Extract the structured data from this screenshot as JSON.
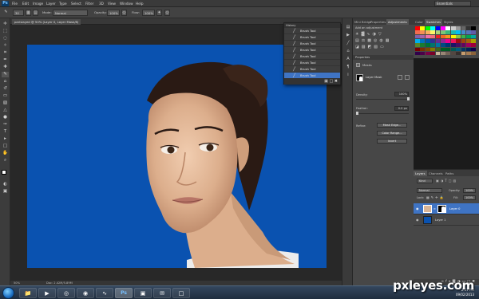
{
  "app": {
    "logo": "Ps",
    "workspace": "Essentials"
  },
  "menu": [
    "File",
    "Edit",
    "Image",
    "Layer",
    "Type",
    "Select",
    "Filter",
    "3D",
    "View",
    "Window",
    "Help"
  ],
  "options": {
    "mode_label": "Mode:",
    "mode_value": "Normal",
    "opacity_label": "Opacity:",
    "opacity_value": "100%",
    "flow_label": "Flow:",
    "flow_value": "100%",
    "brush_size": "30"
  },
  "document": {
    "tab_title": "parislayed @ 50% (Layer 0, Layer Mask/8)"
  },
  "history": {
    "tabs": [
      "History",
      "Actions"
    ],
    "items": [
      "Brush Tool",
      "Brush Tool",
      "Brush Tool",
      "Brush Tool",
      "Brush Tool",
      "Brush Tool",
      "Brush Tool",
      "Brush Tool"
    ]
  },
  "panels": {
    "tabs": [
      "Mini Bridge",
      "Properties",
      "Adjustments"
    ],
    "adjustments_label": "Add an adjustment",
    "properties_title": "Masks",
    "layer_mask_label": "Layer Mask",
    "density_label": "Density:",
    "density_value": "100%",
    "feather_label": "Feather:",
    "feather_value": "0.0 px",
    "refine_label": "Refine:",
    "mask_edge_btn": "Mask Edge...",
    "color_range_btn": "Color Range...",
    "invert_btn": "Invert"
  },
  "swatches": {
    "tabs": [
      "Color",
      "Swatches",
      "Styles"
    ],
    "colors": [
      "#ff0000",
      "#ffff00",
      "#00ff00",
      "#00ffff",
      "#0000ff",
      "#ff00ff",
      "#ffffff",
      "#cccccc",
      "#999999",
      "#666666",
      "#333333",
      "#000000",
      "#f26c4f",
      "#f68e56",
      "#fbaf5d",
      "#fff568",
      "#acd373",
      "#7cc576",
      "#3bb878",
      "#1abbb4",
      "#00bff3",
      "#438ccb",
      "#5574b9",
      "#605ca8",
      "#855fa8",
      "#a763a8",
      "#f06ea9",
      "#f26d7d",
      "#ed1c24",
      "#f26522",
      "#f7941d",
      "#fff200",
      "#8dc63f",
      "#39b54a",
      "#00a651",
      "#00a99d",
      "#00aeef",
      "#0072bc",
      "#0054a6",
      "#2e3192",
      "#662d91",
      "#92278f",
      "#ec008c",
      "#ed145b",
      "#9e0b0f",
      "#a0410d",
      "#a3620a",
      "#aba000",
      "#598527",
      "#197b30",
      "#007236",
      "#00746b",
      "#0076a3",
      "#004a80",
      "#003471",
      "#1b1464",
      "#440e62",
      "#630460",
      "#9e005d",
      "#9e0039",
      "#790000",
      "#7b2e00",
      "#7d4900",
      "#827b00",
      "#406618",
      "#005e20",
      "#005826",
      "#005952",
      "#005b7f",
      "#003663",
      "#002157",
      "#0d004c",
      "#32004b",
      "#4b0049",
      "#7b0046",
      "#7a0026",
      "#c7b299",
      "#998675",
      "#736357",
      "#534741",
      "#362f2d",
      "#c69c6d",
      "#a67c52",
      "#8c6239"
    ]
  },
  "layers": {
    "tabs": [
      "Layers",
      "Channels",
      "Paths"
    ],
    "kind_label": "Kind",
    "blend_mode": "Normal",
    "opacity_label": "Opacity:",
    "opacity_value": "100%",
    "lock_label": "Lock:",
    "fill_label": "Fill:",
    "fill_value": "100%",
    "items": [
      {
        "name": "Layer 0",
        "selected": true
      },
      {
        "name": "Layer 1",
        "selected": false
      }
    ]
  },
  "status": {
    "zoom": "50%",
    "doc_size": "Doc: 2.42M/5.89M"
  },
  "taskbar": {
    "apps": [
      "folder-icon",
      "media-icon",
      "chrome-icon",
      "firefox-icon",
      "wave-icon",
      "photoshop-icon",
      "bridge-icon",
      "mail-icon",
      "window-icon"
    ],
    "time": "2:57 PM",
    "date": "09/02/2013"
  },
  "watermark": "pxleyes.com"
}
